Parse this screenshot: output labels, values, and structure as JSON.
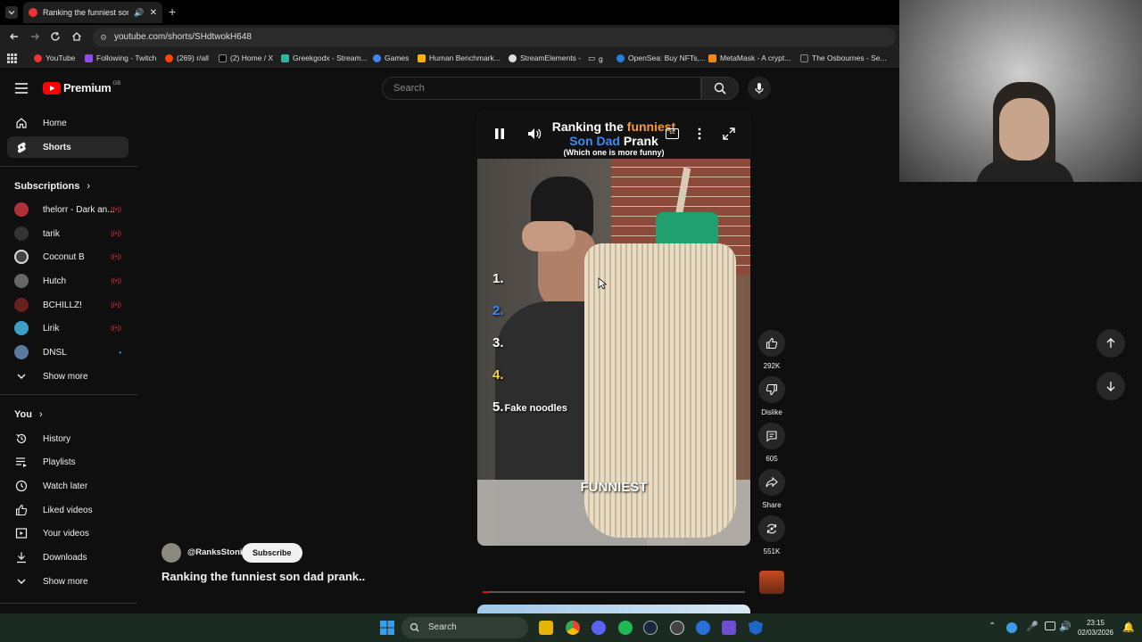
{
  "browser": {
    "tab_title": "Ranking the funniest son dad prank",
    "url": "youtube.com/shorts/SHdtwokH648",
    "bookmarks": [
      "YouTube",
      "Following - Twitch",
      "(269) r/all",
      "(2) Home / X",
      "Greekgodx - Stream...",
      "Games",
      "Human Benchmark...",
      "StreamElements -",
      "g",
      "OpenSea: Buy NFTs,...",
      "MetaMask - A crypt...",
      "The Osbournes - Se..."
    ]
  },
  "youtube": {
    "logo_text": "Premium",
    "region": "GB",
    "search_placeholder": "Search",
    "nav": [
      {
        "label": "Home",
        "icon": "home-icon"
      },
      {
        "label": "Shorts",
        "icon": "shorts-icon"
      }
    ],
    "subscriptions_title": "Subscriptions",
    "subscriptions": [
      {
        "label": "thelorr - Dark an...",
        "color": "#b0303a"
      },
      {
        "label": "tarik",
        "color": "#333333"
      },
      {
        "label": "Coconut B",
        "color": "#444444"
      },
      {
        "label": "Hutch",
        "color": "#666666"
      },
      {
        "label": "BCHILLZ!",
        "color": "#6a1f1f"
      },
      {
        "label": "Lirik",
        "color": "#3aa0c8"
      },
      {
        "label": "DNSL",
        "color": "#5a7aa0"
      }
    ],
    "show_more": "Show more",
    "you_title": "You",
    "you_items": [
      {
        "label": "History",
        "icon": "history-icon"
      },
      {
        "label": "Playlists",
        "icon": "playlists-icon"
      },
      {
        "label": "Watch later",
        "icon": "watch-later-icon"
      },
      {
        "label": "Liked videos",
        "icon": "liked-videos-icon"
      },
      {
        "label": "Your videos",
        "icon": "your-videos-icon"
      },
      {
        "label": "Downloads",
        "icon": "downloads-icon"
      }
    ],
    "show_more_2": "Show more"
  },
  "short": {
    "title_line1_a": "Ranking the ",
    "title_line1_b": "funniest",
    "title_line2_a": "Son Dad",
    "title_line2_b": " Prank",
    "title_line3": "(Which one is more funny)",
    "ranks": [
      "1.",
      "2.",
      "3.",
      "4.",
      "5."
    ],
    "rank5_label": "Fake noodles",
    "overlay_word": "FUNNIEST",
    "channel": "@RanksStoni",
    "subscribe": "Subscribe",
    "video_title": "Ranking the funniest son dad prank..",
    "progress": 0.02
  },
  "actions": {
    "likes": "292K",
    "dislike": "Dislike",
    "comments": "605",
    "share": "Share",
    "remix": "551K"
  },
  "taskbar": {
    "search": "Search",
    "time": "23:15",
    "date": "02/03/2026"
  }
}
